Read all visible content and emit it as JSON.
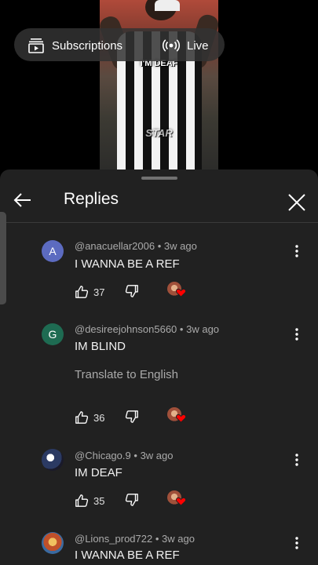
{
  "video": {
    "overlay_top": "I'M DEAF",
    "overlay_bottom": "STAR"
  },
  "top_bar": {
    "subscriptions_label": "Subscriptions",
    "live_label": "Live"
  },
  "panel": {
    "title": "Replies"
  },
  "comments": [
    {
      "avatar_letter": "A",
      "handle": "@anacuellar2006",
      "time": "3w ago",
      "text": "I WANNA BE A REF",
      "likes": "37"
    },
    {
      "avatar_letter": "G",
      "handle": "@desireejohnson5660",
      "time": "3w ago",
      "text": "IM BLIND",
      "translate": "Translate to English",
      "likes": "36"
    },
    {
      "handle": "@Chicago.9",
      "time": "3w ago",
      "text": "IM DEAF",
      "likes": "35"
    },
    {
      "handle": "@Lions_prod722",
      "time": "3w ago",
      "text": "I WANNA BE A REF"
    }
  ],
  "separator": "•",
  "colors": {
    "panel_bg": "#212121",
    "meta_text": "#aaaaaa",
    "heart": "#ff0000"
  }
}
